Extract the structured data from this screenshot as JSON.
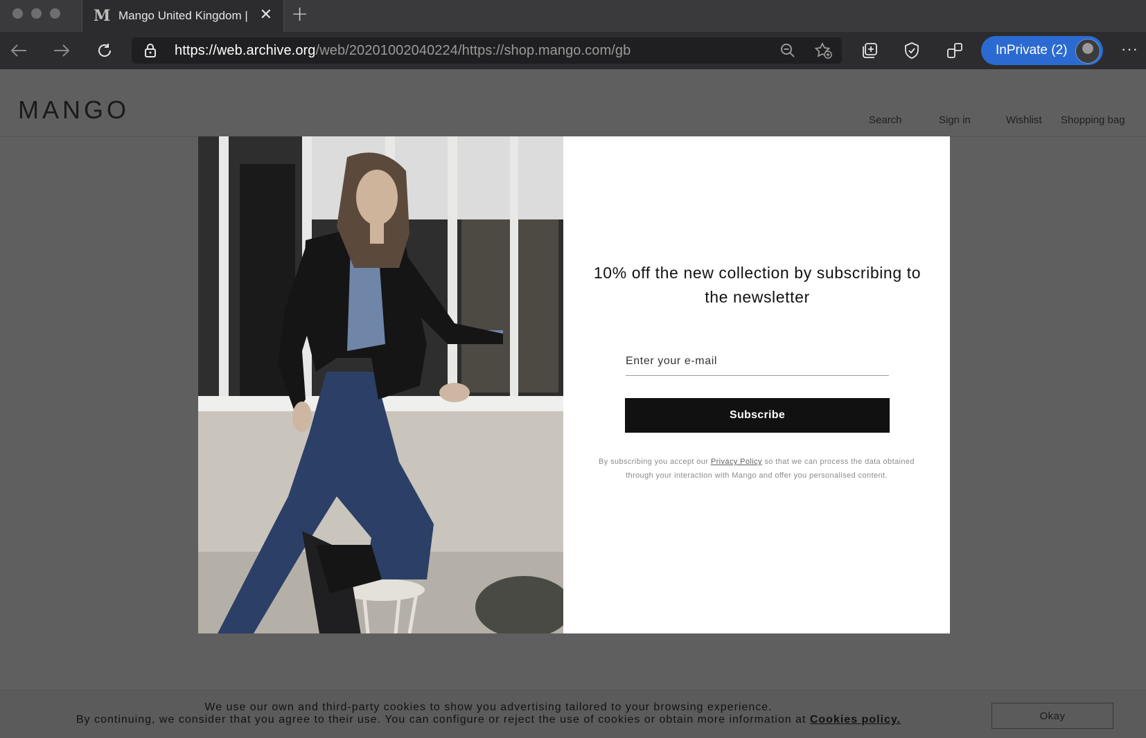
{
  "browser": {
    "tab": {
      "favicon": "M",
      "title": "Mango United Kingdom |"
    },
    "url": {
      "scheme": "https://",
      "host": "web.archive.org",
      "path": "/web/20201002040224/https://shop.mango.com/gb"
    },
    "profile_label": "InPrivate (2)",
    "more_label": "···"
  },
  "site": {
    "logo": "MANGO",
    "nav": [
      "Search",
      "Sign in",
      "Wishlist",
      "Shopping bag"
    ]
  },
  "newsletter": {
    "headline": "10% off the new collection by subscribing to the newsletter",
    "email_placeholder": "Enter your e-mail",
    "subscribe_label": "Subscribe",
    "legal_before": "By subscribing you accept our ",
    "legal_link": "Privacy Policy",
    "legal_after": " so that we can process the data obtained through your interaction with Mango and offer you personalised content."
  },
  "cookies": {
    "line1": "We use our own and third-party cookies to show you advertising tailored to your browsing experience.",
    "line2": "By continuing, we consider that you agree to their use. You can configure or reject the use of cookies or obtain more information at ",
    "link": "Cookies policy.",
    "okay_label": "Okay"
  }
}
